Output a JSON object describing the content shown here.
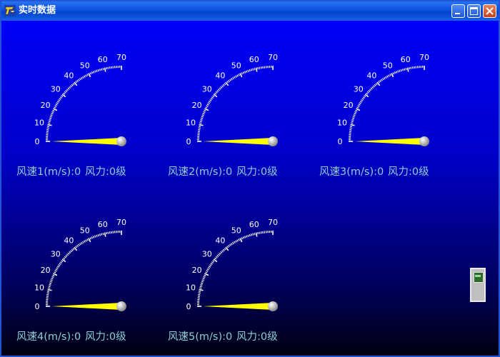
{
  "window": {
    "title": "实时数据",
    "icon": "app-icon",
    "buttons": [
      "minimize-icon",
      "maximize-icon",
      "close-icon"
    ]
  },
  "gauge_scale": {
    "min": 0,
    "max": 70,
    "tick_labels": [
      "0",
      "10",
      "20",
      "30",
      "40",
      "50",
      "60",
      "70"
    ],
    "needle_color": "#ffff00",
    "tick_color": "#ffffff",
    "label_color": "#ffffff"
  },
  "gauges": [
    {
      "speed_label": "风速1(m/s):0",
      "force_label": "风力:0级",
      "value": 0
    },
    {
      "speed_label": "风速2(m/s):0",
      "force_label": "风力:0级",
      "value": 0
    },
    {
      "speed_label": "风速3(m/s):0",
      "force_label": "风力:0级",
      "value": 0
    },
    {
      "speed_label": "风速4(m/s):0",
      "force_label": "风力:0级",
      "value": 0
    },
    {
      "speed_label": "风速5(m/s):0",
      "force_label": "风力:0级",
      "value": 0
    }
  ],
  "colors": {
    "caption": "#8ccfd8",
    "background_top": "#0000f8",
    "background_bottom": "#000010"
  }
}
